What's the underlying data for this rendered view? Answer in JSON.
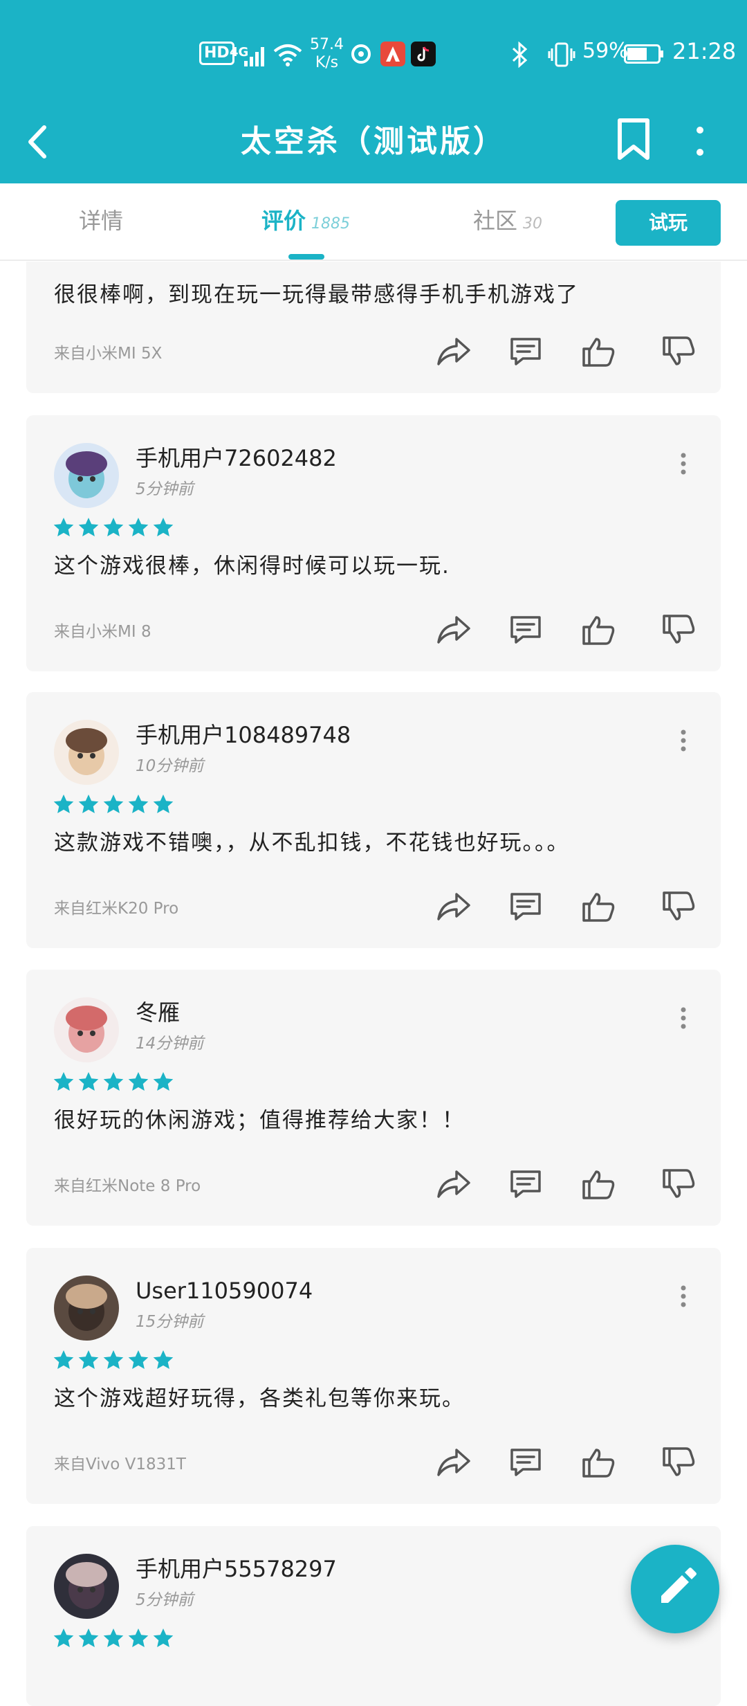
{
  "status_bar": {
    "hd": "HD",
    "network": "4G",
    "speed_value": "57.4",
    "speed_unit": "K/s",
    "battery_percent": "59%",
    "time": "21:28"
  },
  "header": {
    "title": "太空杀（测试版）"
  },
  "tabs": [
    {
      "label": "详情",
      "count": ""
    },
    {
      "label": "评价",
      "count": "1885"
    },
    {
      "label": "社区",
      "count": "30"
    }
  ],
  "try_button": "试玩",
  "colors": {
    "accent": "#1bb3c6",
    "card_bg": "#f6f6f6",
    "star": "#1bb3c6"
  },
  "reviews": [
    {
      "content": "很很棒啊，到现在玩一玩得最带感得手机手机游戏了",
      "device": "来自小米MI 5X"
    },
    {
      "username": "手机用户72602482",
      "time": "5分钟前",
      "rating": 5,
      "content": "这个游戏很棒，休闲得时候可以玩一玩.",
      "device": "来自小米MI 8"
    },
    {
      "username": "手机用户108489748",
      "time": "10分钟前",
      "rating": 5,
      "content": "这款游戏不错噢，，从不乱扣钱，不花钱也好玩。。。",
      "device": "来自红米K20 Pro"
    },
    {
      "username": "冬雁",
      "time": "14分钟前",
      "rating": 5,
      "content": "很好玩的休闲游戏；值得推荐给大家！！",
      "device": "来自红米Note 8 Pro"
    },
    {
      "username": "User110590074",
      "time": "15分钟前",
      "rating": 5,
      "content": "这个游戏超好玩得，各类礼包等你来玩。",
      "device": "来自Vivo V1831T"
    },
    {
      "username": "手机用户55578297",
      "time": "5分钟前",
      "rating": 5
    }
  ]
}
